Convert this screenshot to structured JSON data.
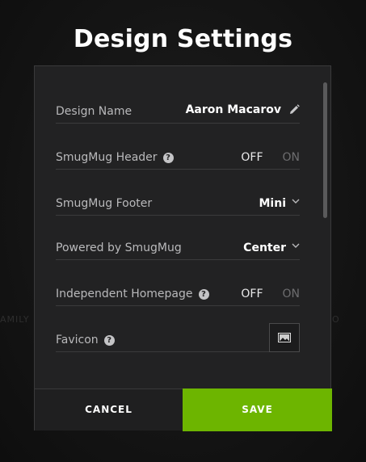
{
  "page": {
    "title": "Design Settings",
    "background_text_left": "AMILY",
    "background_text_right": "O"
  },
  "settings": {
    "design_name": {
      "label": "Design Name",
      "value": "Aaron Macarov",
      "icon": "pencil-icon"
    },
    "header": {
      "label": "SmugMug Header",
      "help_icon": "question-icon",
      "off_label": "OFF",
      "on_label": "ON",
      "state": "OFF"
    },
    "footer": {
      "label": "SmugMug Footer",
      "value": "Mini",
      "icon": "chevron-down-icon"
    },
    "powered_by": {
      "label": "Powered by SmugMug",
      "value": "Center",
      "icon": "chevron-down-icon"
    },
    "homepage": {
      "label": "Independent Homepage",
      "help_icon": "question-icon",
      "off_label": "OFF",
      "on_label": "ON",
      "state": "OFF"
    },
    "favicon": {
      "label": "Favicon",
      "help_icon": "question-icon",
      "icon": "image-icon"
    }
  },
  "actions": {
    "cancel_label": "CANCEL",
    "save_label": "SAVE"
  },
  "colors": {
    "save": "#6db500",
    "dialog": "#222223",
    "text_label": "#b9b9bb"
  }
}
